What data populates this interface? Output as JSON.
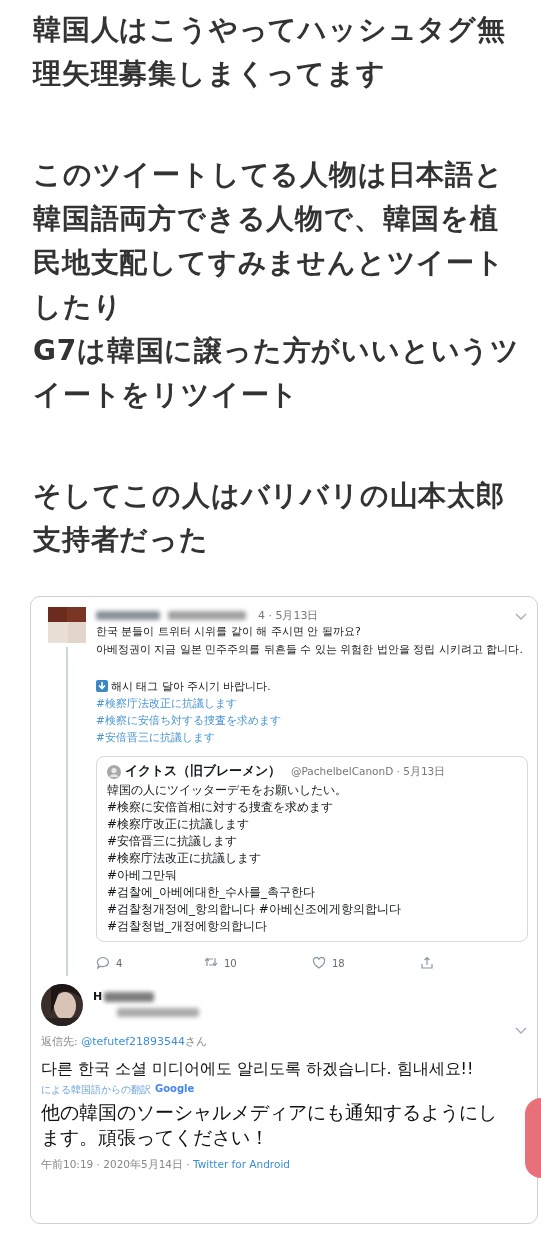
{
  "article": {
    "paragraphs": [
      "韓国人はこうやってハッシュタグ無理矢理募集しまくってます",
      "このツイートしてる人物は日本語と韓国語両方できる人物で、韓国を植民地支配してすみませんとツイートしたり\n**G7**は韓国に譲った方がいいというツイートをリツイート",
      "そしてこの人はバリバリの山本太郎支持者だった"
    ]
  },
  "embedded_tweet": {
    "tweet": {
      "meta": "4 · 5月13日",
      "text": "한국 분들이 트위터 시위를 같이 해 주시면 안 될까요?\n아베정권이 지금 일본 민주주의를 뒤흔들 수 있는 위험한 법안을 정립 시키려고 합니다.",
      "prompt": "해시 태그 달아 주시기 바랍니다.",
      "hashtags": [
        "#検察庁法改正に抗議します",
        "#検察に安倍ち対する捜査を求めます",
        "#安倍晋三に抗議します"
      ],
      "quote": {
        "name": "イクトス（旧ブレーメン）",
        "handle_date": "@PachelbelCanonD · 5月13日",
        "lines": [
          "韓国の人にツイッターデモをお願いしたい。",
          "#検察に安倍首相に対する捜査を求めます",
          "#検察庁改正に抗議します",
          "#安倍晋三に抗議します",
          "#検察庁法改正に抗議します",
          "#아베그만둬",
          "#검찰에_아베에대한_수사를_촉구한다",
          "#검찰청개정에_항의합니다 #아베신조에게항의합니다",
          "#검찰청법_개정에항의합니다"
        ]
      },
      "actions": [
        {
          "kind": "reply",
          "count": "4"
        },
        {
          "kind": "retweet",
          "count": "10"
        },
        {
          "kind": "like",
          "count": "18"
        },
        {
          "kind": "share"
        }
      ]
    },
    "reply": {
      "name_initial": "H",
      "reply_to_label": "返信先: ",
      "reply_to_handle": "@tefutef21893544",
      "reply_to_suffix": "さん",
      "text": "다른 한국 소셜 미디어에도 알리도록 하겠습니다. 힘내세요!!",
      "translation_label": "による韓国語からの翻訳",
      "translation_brand": "Google",
      "translation": "他の韓国のソーシャルメディアにも通知するようにします。頑張ってください！",
      "time": "午前10:19 · 2020年5月14日 · ",
      "source": "Twitter for Android"
    }
  }
}
